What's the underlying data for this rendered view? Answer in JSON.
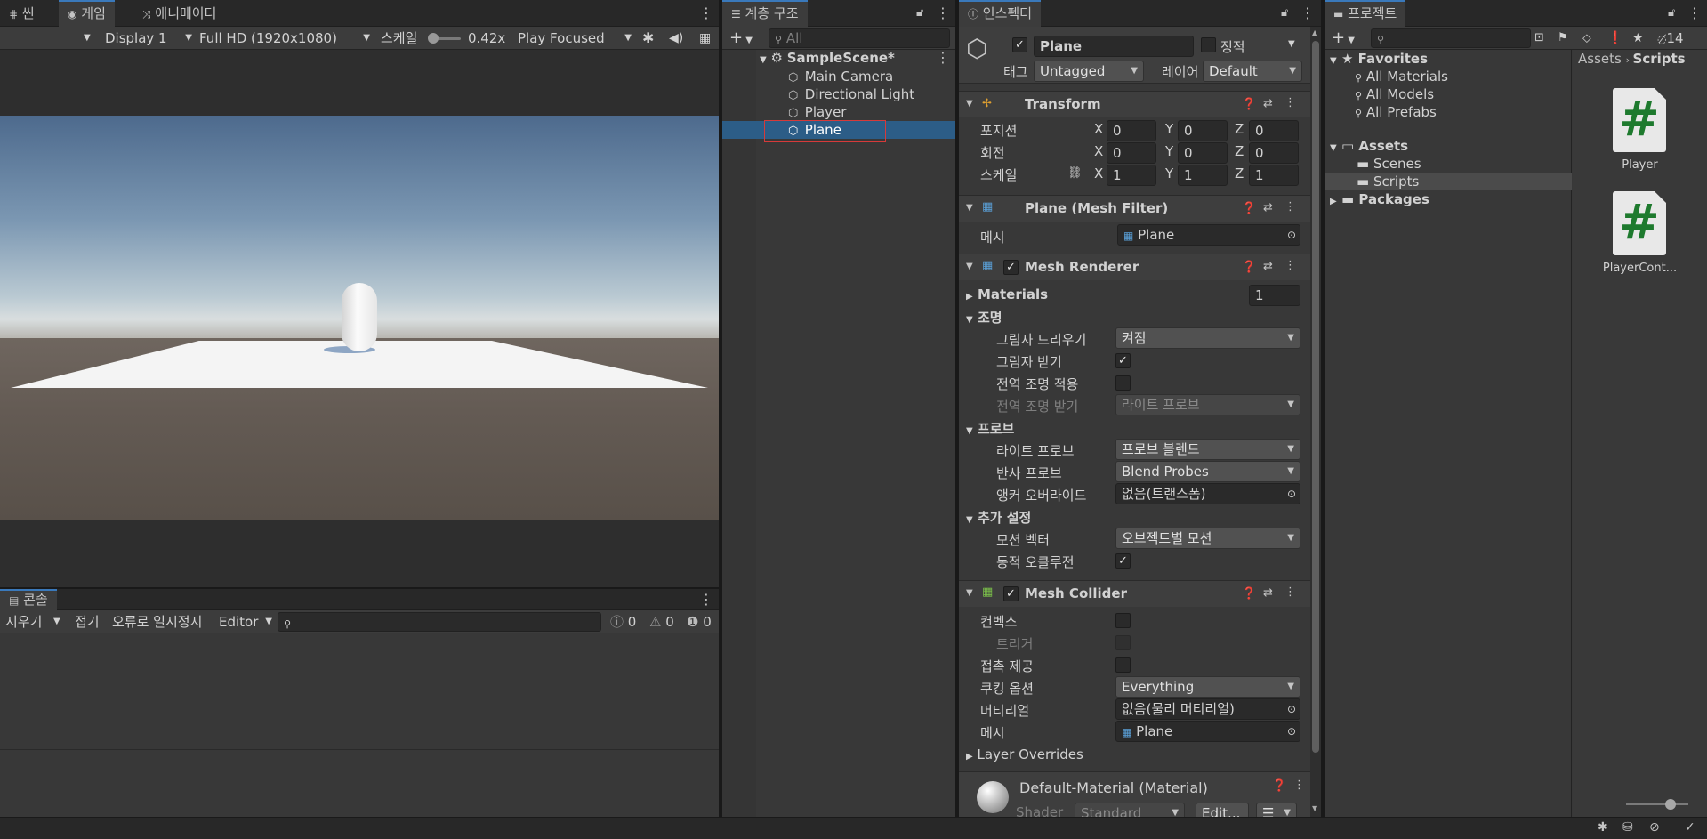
{
  "game_panel": {
    "tabs": [
      "씬",
      "게임",
      "애니메이터"
    ],
    "toolbar": {
      "display": "Display 1",
      "resolution": "Full HD (1920x1080)",
      "scale_label": "스케일",
      "scale_value": "0.42x",
      "play_mode": "Play Focused"
    }
  },
  "hierarchy": {
    "tab": "계층 구조",
    "search_placeholder": "All",
    "scene": "SampleScene*",
    "items": [
      "Main Camera",
      "Directional Light",
      "Player",
      "Plane"
    ],
    "selected": "Plane"
  },
  "inspector": {
    "tab": "인스펙터",
    "object_name": "Plane",
    "static_label": "정적",
    "tag_label": "태그",
    "tag_value": "Untagged",
    "layer_label": "레이어",
    "layer_value": "Default",
    "transform": {
      "title": "Transform",
      "position_label": "포지션",
      "rotation_label": "회전",
      "scale_label": "스케일",
      "position": [
        "0",
        "0",
        "0"
      ],
      "rotation": [
        "0",
        "0",
        "0"
      ],
      "scale": [
        "1",
        "1",
        "1"
      ],
      "axes": [
        "X",
        "Y",
        "Z"
      ]
    },
    "mesh_filter": {
      "title": "Plane (Mesh Filter)",
      "mesh_label": "메시",
      "mesh_value": "Plane"
    },
    "mesh_renderer": {
      "title": "Mesh Renderer",
      "materials_label": "Materials",
      "materials_count": "1",
      "lighting_label": "조명",
      "cast_shadows_label": "그림자 드리우기",
      "cast_shadows_value": "켜짐",
      "receive_shadows_label": "그림자 받기",
      "contribute_gi_label": "전역 조명 적용",
      "receive_gi_label": "전역 조명 받기",
      "receive_gi_value": "라이트 프로브",
      "probes_label": "프로브",
      "light_probes_label": "라이트 프로브",
      "light_probes_value": "프로브 블렌드",
      "reflection_probes_label": "반사 프로브",
      "reflection_probes_value": "Blend Probes",
      "anchor_override_label": "앵커 오버라이드",
      "anchor_override_value": "없음(트랜스폼)",
      "additional_label": "추가 설정",
      "motion_vectors_label": "모션 벡터",
      "motion_vectors_value": "오브젝트별 모션",
      "dynamic_occlusion_label": "동적 오클루전"
    },
    "mesh_collider": {
      "title": "Mesh Collider",
      "convex_label": "컨벡스",
      "trigger_label": "트리거",
      "contact_label": "접촉 제공",
      "cooking_label": "쿠킹 옵션",
      "cooking_value": "Everything",
      "material_label": "머티리얼",
      "material_value": "없음(물리 머티리얼)",
      "mesh_label": "메시",
      "mesh_value": "Plane",
      "layer_overrides_label": "Layer Overrides"
    },
    "material": {
      "name": "Default-Material (Material)",
      "shader_label": "Shader",
      "shader_value": "Standard",
      "edit_label": "Edit..."
    }
  },
  "project": {
    "tab": "프로젝트",
    "count": "14",
    "favorites_label": "Favorites",
    "favorites": [
      "All Materials",
      "All Models",
      "All Prefabs"
    ],
    "assets_label": "Assets",
    "asset_folders": [
      "Scenes",
      "Scripts"
    ],
    "packages_label": "Packages",
    "breadcrumb": [
      "Assets",
      "Scripts"
    ],
    "files": [
      "Player",
      "PlayerCont..."
    ],
    "script_glyph": "#"
  },
  "console": {
    "tab": "콘솔",
    "clear_label": "지우기",
    "collapse_label": "접기",
    "error_pause_label": "오류로 일시정지",
    "editor_label": "Editor",
    "log_count": "0",
    "warn_count": "0",
    "error_count": "0"
  },
  "colors": {
    "accent": "#3a79bb",
    "selection": "#2c5d87",
    "panel": "#383838",
    "script_green": "#1e7a2e"
  }
}
